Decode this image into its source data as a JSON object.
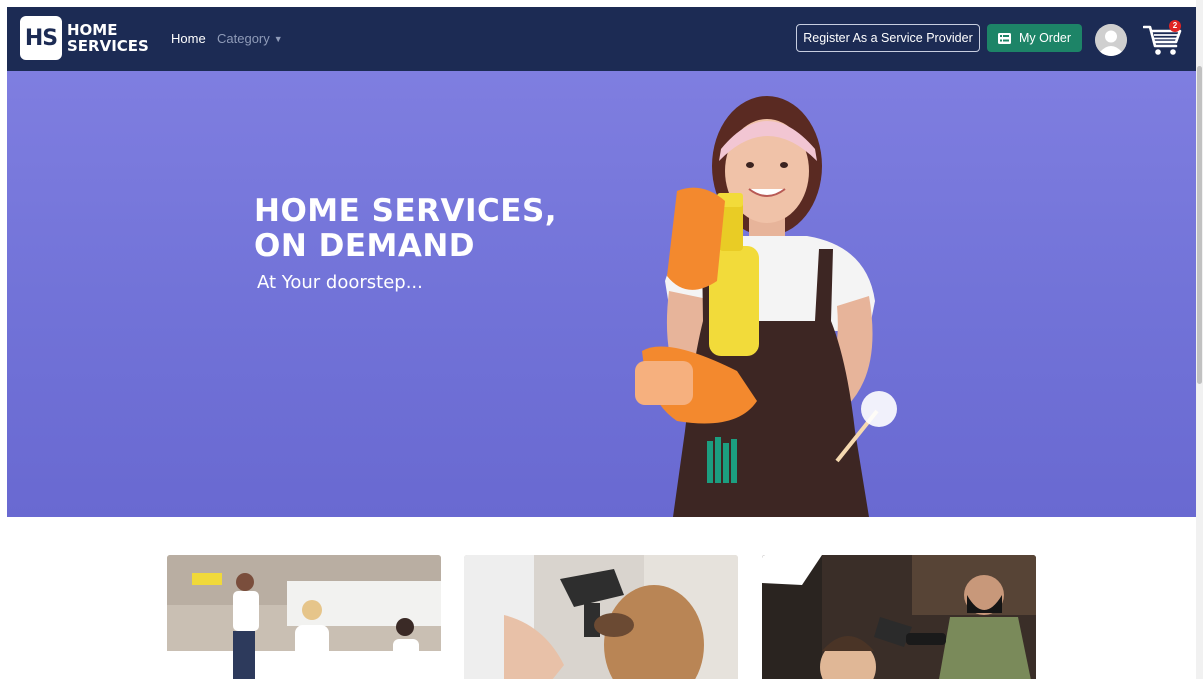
{
  "brand": {
    "logo_mark": "HS",
    "line1": "HOME",
    "line2": "SERVICES"
  },
  "nav": {
    "home": "Home",
    "category": "Category",
    "register_button": "Register As a Service Provider",
    "my_order_button": "My Order",
    "cart_count": "2",
    "icons": [
      "list-icon",
      "avatar-icon",
      "cart-icon",
      "caret-down-icon"
    ]
  },
  "hero": {
    "title_line1": "HOME SERVICES,",
    "title_line2": "ON DEMAND",
    "subtitle": "At Your doorstep..."
  },
  "colors": {
    "navbar": "#1c2b54",
    "hero": "#7575da",
    "order_button": "#1d8467",
    "badge": "#e02424"
  }
}
